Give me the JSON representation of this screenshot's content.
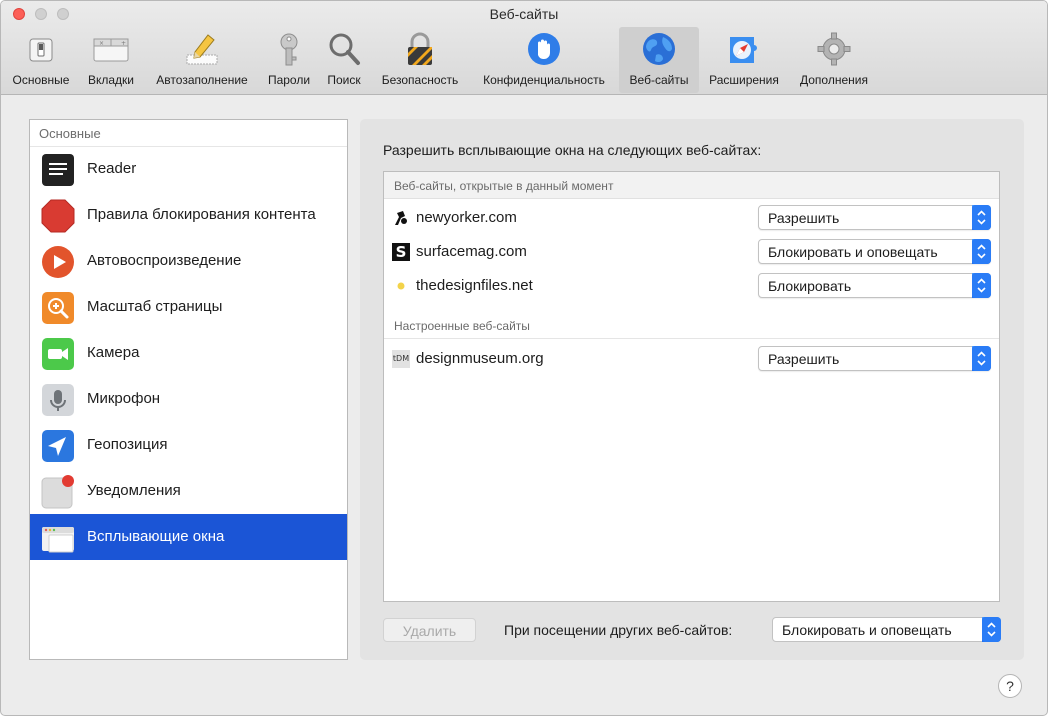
{
  "window": {
    "title": "Веб-сайты"
  },
  "toolbar": {
    "items": [
      {
        "label": "Основные",
        "icon": "general-switch-icon"
      },
      {
        "label": "Вкладки",
        "icon": "tabs-icon"
      },
      {
        "label": "Автозаполнение",
        "icon": "pencil-form-icon"
      },
      {
        "label": "Пароли",
        "icon": "key-icon"
      },
      {
        "label": "Поиск",
        "icon": "magnifier-icon"
      },
      {
        "label": "Безопасность",
        "icon": "padlock-icon"
      },
      {
        "label": "Конфиденциальность",
        "icon": "hand-icon"
      },
      {
        "label": "Веб-сайты",
        "icon": "globe-icon",
        "active": true
      },
      {
        "label": "Расширения",
        "icon": "puzzle-compass-icon"
      },
      {
        "label": "Дополнения",
        "icon": "gear-icon"
      }
    ]
  },
  "sidebar": {
    "header": "Основные",
    "items": [
      {
        "label": "Reader",
        "icon": "reader-icon"
      },
      {
        "label": "Правила блокирования контента",
        "icon": "stop-sign-icon"
      },
      {
        "label": "Автовоспроизведение",
        "icon": "play-icon"
      },
      {
        "label": "Масштаб страницы",
        "icon": "zoom-icon"
      },
      {
        "label": "Камера",
        "icon": "camera-icon"
      },
      {
        "label": "Микрофон",
        "icon": "microphone-icon"
      },
      {
        "label": "Геопозиция",
        "icon": "location-arrow-icon"
      },
      {
        "label": "Уведомления",
        "icon": "notification-icon"
      },
      {
        "label": "Всплывающие окна",
        "icon": "popup-window-icon",
        "selected": true
      }
    ]
  },
  "main": {
    "caption": "Разрешить всплывающие окна на следующих веб-сайтах:",
    "section_open": "Веб-сайты, открытые в данный момент",
    "section_configured": "Настроенные веб-сайты",
    "open_sites": [
      {
        "site": "newyorker.com",
        "setting": "Разрешить",
        "favicon": "newyorker-favicon"
      },
      {
        "site": "surfacemag.com",
        "setting": "Блокировать и оповещать",
        "favicon": "surfacemag-favicon",
        "favicon_text": "S"
      },
      {
        "site": "thedesignfiles.net",
        "setting": "Блокировать",
        "favicon": "thedesignfiles-favicon"
      }
    ],
    "configured_sites": [
      {
        "site": "designmuseum.org",
        "setting": "Разрешить",
        "favicon": "designmuseum-favicon",
        "favicon_text": "tDM"
      }
    ],
    "remove_label": "Удалить",
    "other_sites_label": "При посещении других веб-сайтов:",
    "other_sites_setting": "Блокировать и оповещать"
  },
  "help": {
    "label": "?"
  },
  "colors": {
    "accent": "#1b55d6",
    "popup_arrows": "#2a7cf6",
    "close": "#fc5f57"
  }
}
